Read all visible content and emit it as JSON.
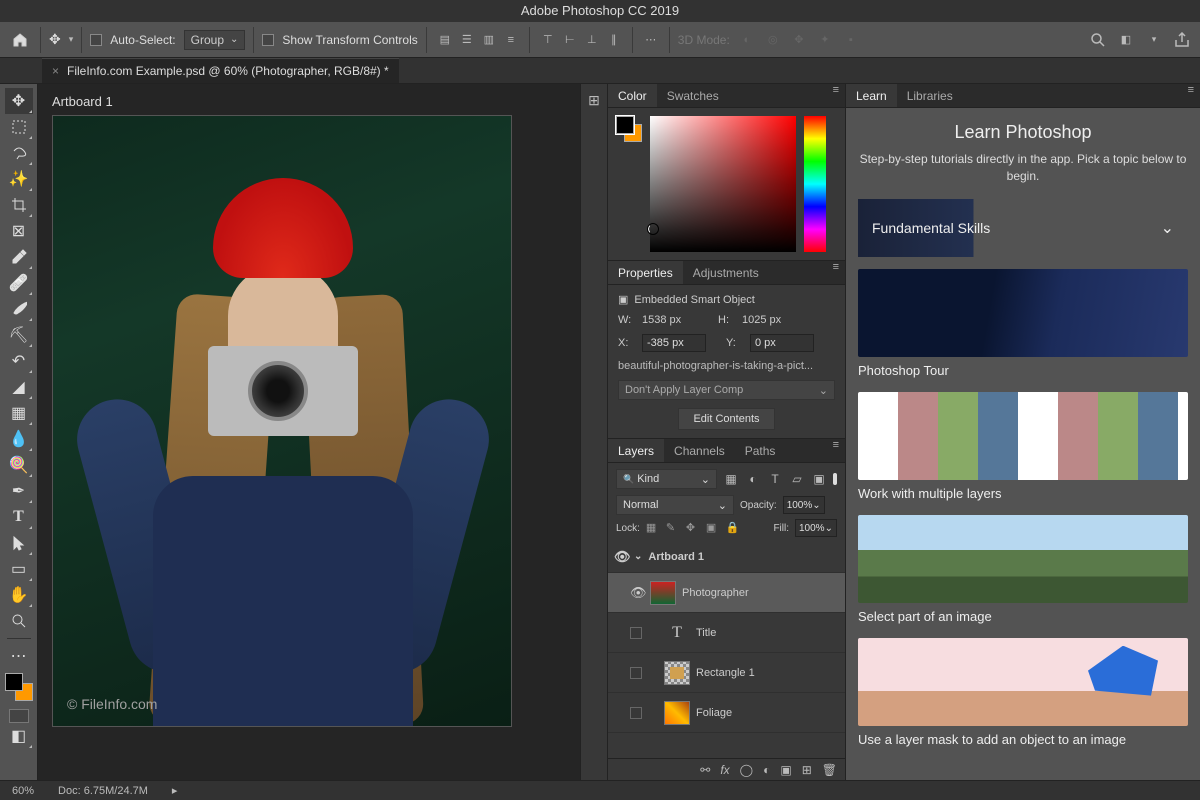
{
  "title": "Adobe Photoshop CC 2019",
  "doc_tab": "FileInfo.com Example.psd @ 60% (Photographer, RGB/8#) *",
  "options": {
    "auto_select_label": "Auto-Select:",
    "auto_select_mode": "Group",
    "show_transform": "Show Transform Controls",
    "three_d_mode": "3D Mode:"
  },
  "artboard_label": "Artboard 1",
  "watermark": "© FileInfo.com",
  "status": {
    "zoom": "60%",
    "doc": "Doc: 6.75M/24.7M"
  },
  "panels": {
    "color": {
      "tabs": [
        "Color",
        "Swatches"
      ]
    },
    "properties": {
      "tabs": [
        "Properties",
        "Adjustments"
      ],
      "kind": "Embedded Smart Object",
      "w_label": "W:",
      "w": "1538 px",
      "h_label": "H:",
      "h": "1025 px",
      "x_label": "X:",
      "x": "-385 px",
      "y_label": "Y:",
      "y": "0 px",
      "so_name": "beautiful-photographer-is-taking-a-pict...",
      "layer_comp": "Don't Apply Layer Comp",
      "edit_btn": "Edit Contents"
    },
    "layers": {
      "tabs": [
        "Layers",
        "Channels",
        "Paths"
      ],
      "kind": "Kind",
      "blend": "Normal",
      "opacity_label": "Opacity:",
      "opacity": "100%",
      "lock_label": "Lock:",
      "fill_label": "Fill:",
      "fill": "100%",
      "rows": [
        {
          "name": "Artboard 1",
          "type": "artboard",
          "visible": true
        },
        {
          "name": "Photographer",
          "type": "smart",
          "visible": true,
          "selected": true
        },
        {
          "name": "Title",
          "type": "type",
          "visible": false
        },
        {
          "name": "Rectangle 1",
          "type": "shape",
          "visible": false
        },
        {
          "name": "Foliage",
          "type": "pixel",
          "visible": false
        }
      ]
    }
  },
  "learn": {
    "tabs": [
      "Learn",
      "Libraries"
    ],
    "title": "Learn Photoshop",
    "subtitle": "Step-by-step tutorials directly in the app. Pick a topic below to begin.",
    "fundamental": "Fundamental Skills",
    "cards": [
      "Photoshop Tour",
      "Work with multiple layers",
      "Select part of an image",
      "Use a layer mask to add an object to an image"
    ]
  }
}
